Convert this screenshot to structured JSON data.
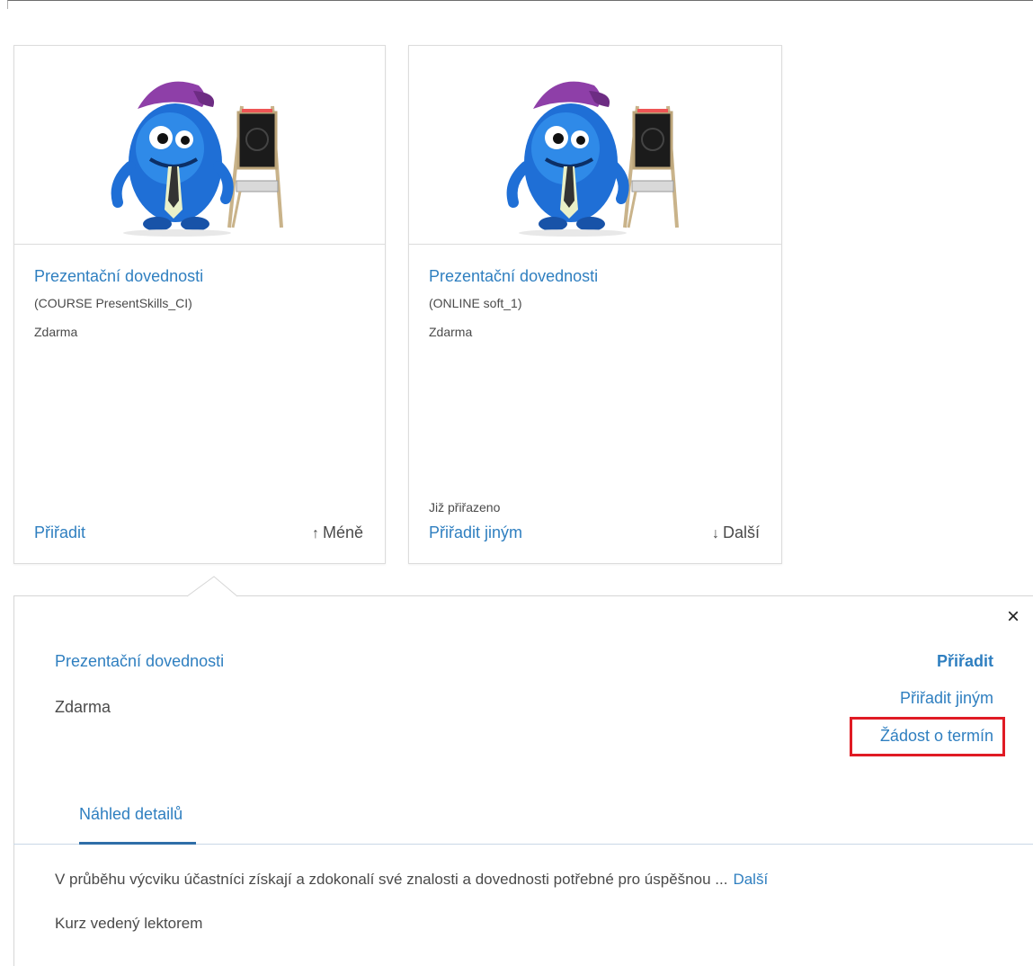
{
  "colors": {
    "link": "#2f7fc0",
    "text": "#4a4a4a",
    "highlight": "#e01b24",
    "tab_underline": "#2f6ea8"
  },
  "cards": [
    {
      "title": "Prezentační dovednosti",
      "code": "(COURSE PresentSkills_CI)",
      "price": "Zdarma",
      "assigned": "",
      "action": "Přiřadit",
      "toggle_arrow": "↑",
      "toggle": "Méně"
    },
    {
      "title": "Prezentační dovednosti",
      "code": "(ONLINE soft_1)",
      "price": "Zdarma",
      "assigned": "Již přiřazeno",
      "action": "Přiřadit jiným",
      "toggle_arrow": "↓",
      "toggle": "Další"
    }
  ],
  "detail": {
    "close": "×",
    "title": "Prezentační dovednosti",
    "price": "Zdarma",
    "actions": {
      "assign": "Přiřadit",
      "assign_other": "Přiřadit jiným",
      "request_date": "Žádost o termín"
    },
    "tab": "Náhled detailů",
    "description": "V průběhu výcviku účastníci získají a zdokonalí své znalosti a dovednosti potřebné pro úspěšnou ...",
    "description_more": "Další",
    "course_type": "Kurz vedený lektorem"
  },
  "icons": {
    "thumbnail": "monster-with-easel-icon"
  }
}
